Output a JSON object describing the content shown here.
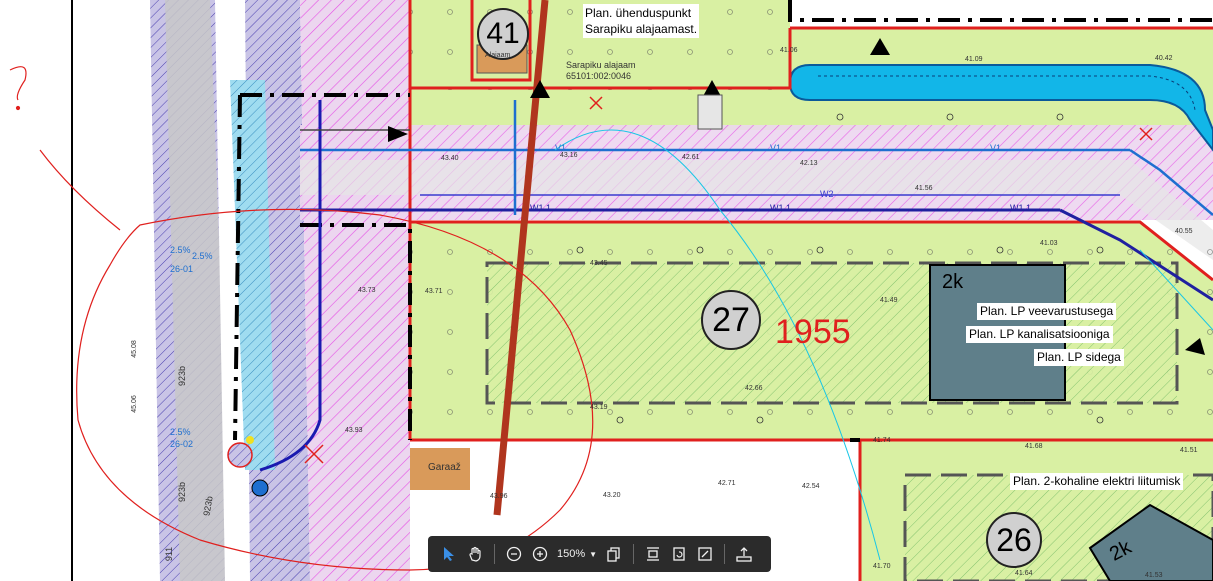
{
  "map": {
    "plot_numbers": {
      "p41": "41",
      "p27": "27",
      "p26": "26"
    },
    "year_label": "1955",
    "building_labels": {
      "b1": "2k",
      "b2": "2k"
    },
    "callouts": {
      "connection_point": "Plan. ühenduspunkt\nSarapiku alajaamast.",
      "water": "Plan. LP veevarustusega",
      "sewer": "Plan. LP kanalisatsiooniga",
      "comm": "Plan. LP sidega",
      "electric": "Plan. 2-kohaline elektri liitumisk"
    },
    "small_labels": {
      "substation": "Sarapiku alajaam",
      "cadastre": "65101:002:0046",
      "garage": "Garaaž",
      "alajaam_short": "Alajaam"
    },
    "utility_codes": {
      "v1": "V1",
      "w1": "W1.1",
      "w2": "W2"
    },
    "road_codes": {
      "r1": "923b",
      "r2": "923b",
      "r3": "923b",
      "r4": "911"
    },
    "slope_labels": {
      "s1": "2.5%",
      "s2": "2.5%",
      "s3": "2.5%",
      "s4": "26-02",
      "s5": "26-01"
    },
    "elevations": {
      "e1": "41.06",
      "e2": "41.09",
      "e3": "40.42",
      "e4": "43.40",
      "e5": "43.16",
      "e6": "42.61",
      "e7": "42.13",
      "e8": "41.56",
      "e9": "41.03",
      "e10": "40.55",
      "e11": "43.45",
      "e12": "41.49",
      "e13": "42.66",
      "e14": "43.19",
      "e15": "43.71",
      "e16": "43.73",
      "e17": "41.74",
      "e18": "41.68",
      "e19": "41.51",
      "e20": "42.71",
      "e21": "42.54",
      "e22": "43.20",
      "e23": "43.96",
      "e24": "41.70",
      "e25": "41.64",
      "e26": "41.53",
      "e27": "45.06",
      "e28": "45.08",
      "e29": "43.93"
    },
    "annotation_mark": "?"
  },
  "colors": {
    "plot_green": "#d9f0a3",
    "hatch_magenta": "#e64fe6",
    "boundary_red": "#e0201e",
    "water_blue": "#1e6fd0",
    "road_gray": "#c8c8c8",
    "building_gray": "#5f7f8a",
    "garage_brown": "#d99a5a",
    "parking_cyan": "#12b6e8"
  },
  "toolbar": {
    "zoom_value": "150%",
    "icons": [
      "pointer-icon",
      "hand-icon",
      "zoom-out-icon",
      "zoom-in-icon",
      "copy-pages-icon",
      "fit-page-icon",
      "rotate-icon",
      "fullscreen-icon",
      "export-icon"
    ]
  }
}
